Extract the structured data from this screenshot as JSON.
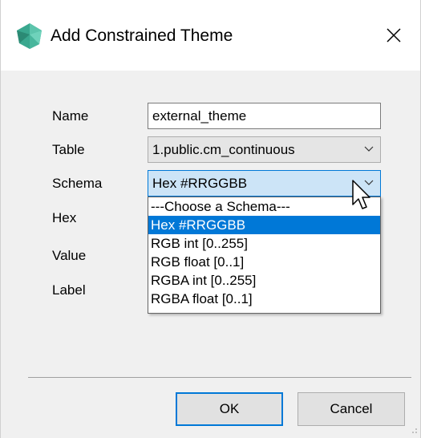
{
  "window": {
    "title": "Add Constrained Theme",
    "accent_color": "#0078d7",
    "icon": "app-logo-icon",
    "close_icon": "close-icon"
  },
  "form": {
    "name_label": "Name",
    "name_value": "external_theme",
    "table_label": "Table",
    "table_value": "1.public.cm_continuous",
    "schema_label": "Schema",
    "schema_value": "Hex #RRGGBB",
    "hex_label": "Hex",
    "value_label": "Value",
    "label_label": "Label"
  },
  "schema_dropdown": {
    "options": [
      {
        "label": "---Choose a Schema---",
        "selected": false
      },
      {
        "label": "Hex #RRGGBB",
        "selected": true
      },
      {
        "label": "RGB int [0..255]",
        "selected": false
      },
      {
        "label": "RGB float [0..1]",
        "selected": false
      },
      {
        "label": "RGBA int [0..255]",
        "selected": false
      },
      {
        "label": "RGBA float [0..1]",
        "selected": false
      }
    ]
  },
  "buttons": {
    "ok": "OK",
    "cancel": "Cancel"
  }
}
